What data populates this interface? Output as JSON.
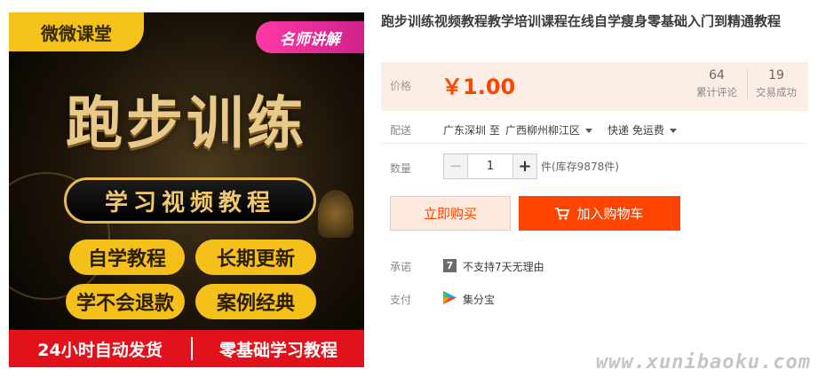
{
  "product_image": {
    "brand": "微微课堂",
    "badge": "名师讲解",
    "headline": "跑步训练",
    "subtitle": "学习视频教程",
    "features": [
      "自学教程",
      "长期更新",
      "学不会退款",
      "案例经典"
    ],
    "bottom_left": "24小时自动发货",
    "bottom_right": "零基础学习教程"
  },
  "product": {
    "title": "跑步训练视频教程教学培训课程在线自学瘦身零基础入门到精通教程"
  },
  "price": {
    "label": "价格",
    "value": "￥1.00",
    "reviews_count": "64",
    "reviews_label": "累计评论",
    "deals_count": "19",
    "deals_label": "交易成功"
  },
  "shipping": {
    "label": "配送",
    "from": "广东深圳 至",
    "to": "广西柳州柳江区",
    "method": "快递 免运费"
  },
  "quantity": {
    "label": "数量",
    "value": "1",
    "minus": "−",
    "plus": "+",
    "stock": "件(库存9878件)"
  },
  "actions": {
    "buy_now": "立即购买",
    "add_to_cart": "加入购物车"
  },
  "promise": {
    "label": "承诺",
    "icon_text": "7",
    "text": "不支持7天无理由"
  },
  "payment": {
    "label": "支付",
    "text": "集分宝"
  },
  "watermark": "www.xunibaoku.com",
  "colors": {
    "accent": "#ff4400",
    "price_bg": "#fdeee5",
    "banner_yellow": "#f6c01a",
    "banner_red": "#e1121b"
  }
}
